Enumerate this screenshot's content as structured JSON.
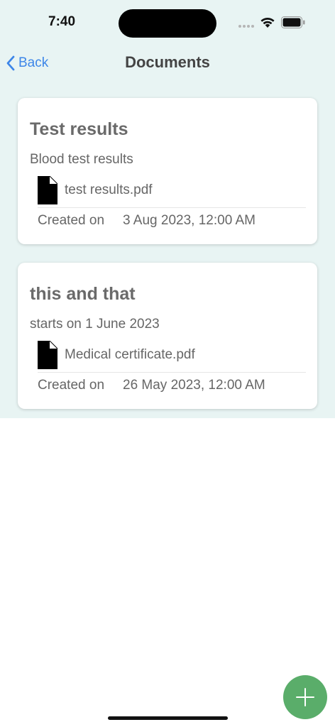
{
  "status_bar": {
    "time": "7:40"
  },
  "nav": {
    "back_label": "Back",
    "title": "Documents"
  },
  "documents": [
    {
      "title": "Test results",
      "subtitle": "Blood test results",
      "file_name": "test results.pdf",
      "created_label": "Created on",
      "created_value": "3 Aug 2023, 12:00 AM"
    },
    {
      "title": "this and that",
      "subtitle": "starts on 1 June 2023",
      "file_name": "Medical certificate.pdf",
      "created_label": "Created on",
      "created_value": "26 May 2023, 12:00 AM"
    }
  ],
  "colors": {
    "accent": "#3d86e8",
    "header_background": "#e8f4f3",
    "fab": "#5aad6a"
  },
  "icons": {
    "back": "chevron-left-icon",
    "file": "document-icon",
    "fab": "plus-icon"
  }
}
